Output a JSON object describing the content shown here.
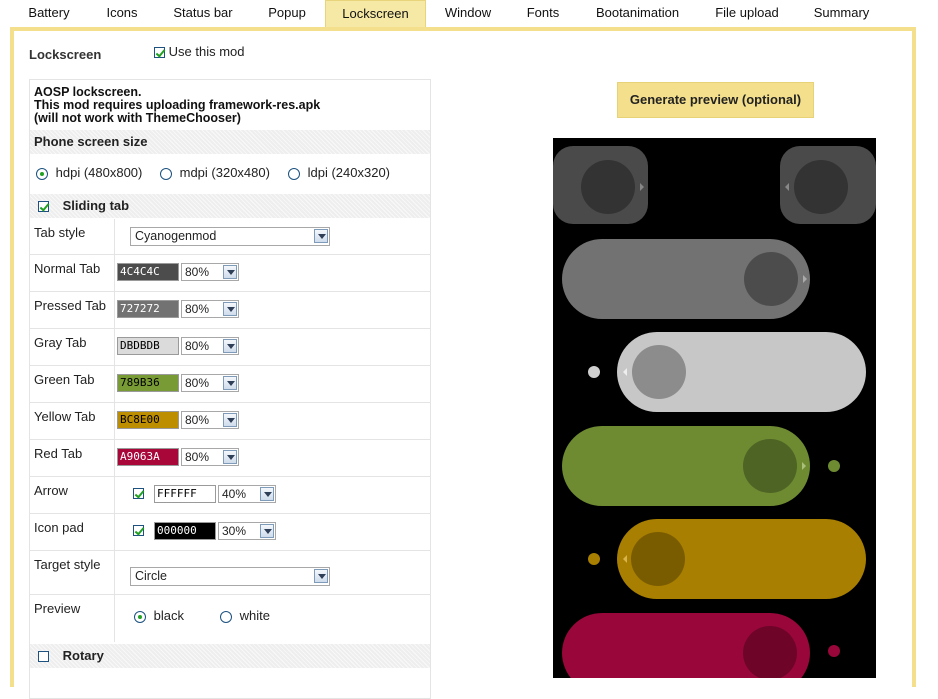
{
  "tabs": [
    "Battery",
    "Icons",
    "Status bar",
    "Popup",
    "Lockscreen",
    "Window",
    "Fonts",
    "Bootanimation",
    "File upload",
    "Summary"
  ],
  "active_tab": "Lockscreen",
  "section": {
    "title": "Lockscreen",
    "use_mod_label": "Use this mod",
    "use_mod_checked": true
  },
  "description": {
    "line1": "AOSP lockscreen.",
    "line2": "This mod requires uploading framework-res.apk",
    "line3": "(will not work with ThemeChooser)"
  },
  "phone_size": {
    "header": "Phone screen size",
    "options": [
      "hdpi (480x800)",
      "mdpi (320x480)",
      "ldpi (240x320)"
    ],
    "selected": "hdpi (480x800)"
  },
  "sliding_tab": {
    "header": "Sliding tab",
    "checked": true
  },
  "tab_style": {
    "label": "Tab style",
    "value": "Cyanogenmod"
  },
  "color_rows": [
    {
      "label": "Normal Tab",
      "hex": "4C4C4C",
      "pct": "80%",
      "bg": "#4C4C4C",
      "fg": "#ffffff"
    },
    {
      "label": "Pressed Tab",
      "hex": "727272",
      "pct": "80%",
      "bg": "#727272",
      "fg": "#ffffff"
    },
    {
      "label": "Gray Tab",
      "hex": "DBDBDB",
      "pct": "80%",
      "bg": "#DBDBDB",
      "fg": "#000000"
    },
    {
      "label": "Green Tab",
      "hex": "789B36",
      "pct": "80%",
      "bg": "#789B36",
      "fg": "#000000"
    },
    {
      "label": "Yellow Tab",
      "hex": "BC8E00",
      "pct": "80%",
      "bg": "#BC8E00",
      "fg": "#000000"
    },
    {
      "label": "Red Tab",
      "hex": "A9063A",
      "pct": "80%",
      "bg": "#A9063A",
      "fg": "#ffffff"
    }
  ],
  "arrow": {
    "label": "Arrow",
    "checked": true,
    "hex": "FFFFFF",
    "pct": "40%",
    "bg": "#FFFFFF",
    "fg": "#000000"
  },
  "icon_pad": {
    "label": "Icon pad",
    "checked": true,
    "hex": "000000",
    "pct": "30%",
    "bg": "#000000",
    "fg": "#ffffff"
  },
  "target_style": {
    "label": "Target style",
    "value": "Circle"
  },
  "preview": {
    "label": "Preview",
    "options": [
      "black",
      "white"
    ],
    "selected": "black"
  },
  "rotary": {
    "header": "Rotary",
    "checked": false
  },
  "generate_button": "Generate preview (optional)",
  "colors": {
    "accent": "#F4E08C",
    "tab_active": "#F6E9A6"
  }
}
